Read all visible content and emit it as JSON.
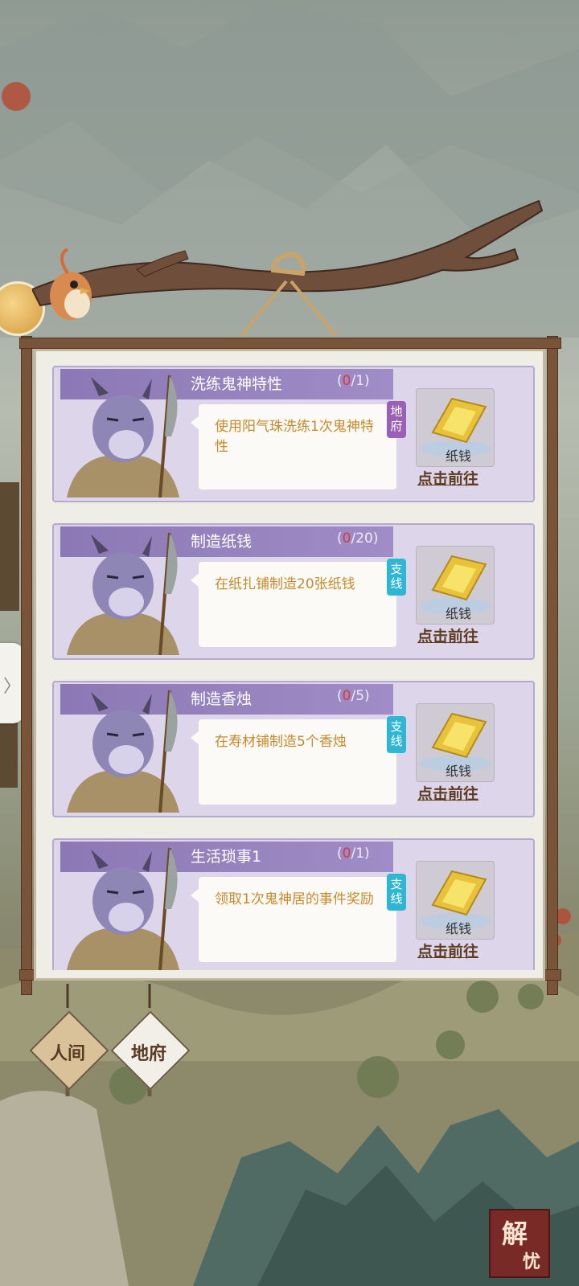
{
  "tasks": [
    {
      "title": "洗练鬼神特性",
      "progress_current": "0",
      "progress_total": "/1)",
      "progress_open": "(",
      "description": "使用阳气珠洗练1次鬼神特性",
      "tag": "地府",
      "tag_color": "#9b5fb7",
      "reward_label": "纸钱",
      "action": "点击前往"
    },
    {
      "title": "制造纸钱",
      "progress_current": "0",
      "progress_total": "/20)",
      "progress_open": "(",
      "description": "在纸扎铺制造20张纸钱",
      "tag": "支线",
      "tag_color": "#2eb6d3",
      "reward_label": "纸钱",
      "action": "点击前往"
    },
    {
      "title": "制造香烛",
      "progress_current": "0",
      "progress_total": "/5)",
      "progress_open": "(",
      "description": "在寿材铺制造5个香烛",
      "tag": "支线",
      "tag_color": "#2eb6d3",
      "reward_label": "纸钱",
      "action": "点击前往"
    },
    {
      "title": "生活琐事1",
      "progress_current": "0",
      "progress_total": "/1)",
      "progress_open": "(",
      "description": "领取1次鬼神居的事件奖励",
      "tag": "支线",
      "tag_color": "#2eb6d3",
      "reward_label": "纸钱",
      "action": "点击前往"
    }
  ],
  "nav": {
    "human_world": "人间",
    "underworld": "地府"
  },
  "stamp": {
    "line1": "解",
    "line2": "忧"
  },
  "side_tab_glyph": "〉",
  "colors": {
    "card_bg": "#ddd6ea",
    "title_band": "#8c78b4",
    "progress_red": "#d93a3a",
    "desc_text": "#c58a2c"
  }
}
